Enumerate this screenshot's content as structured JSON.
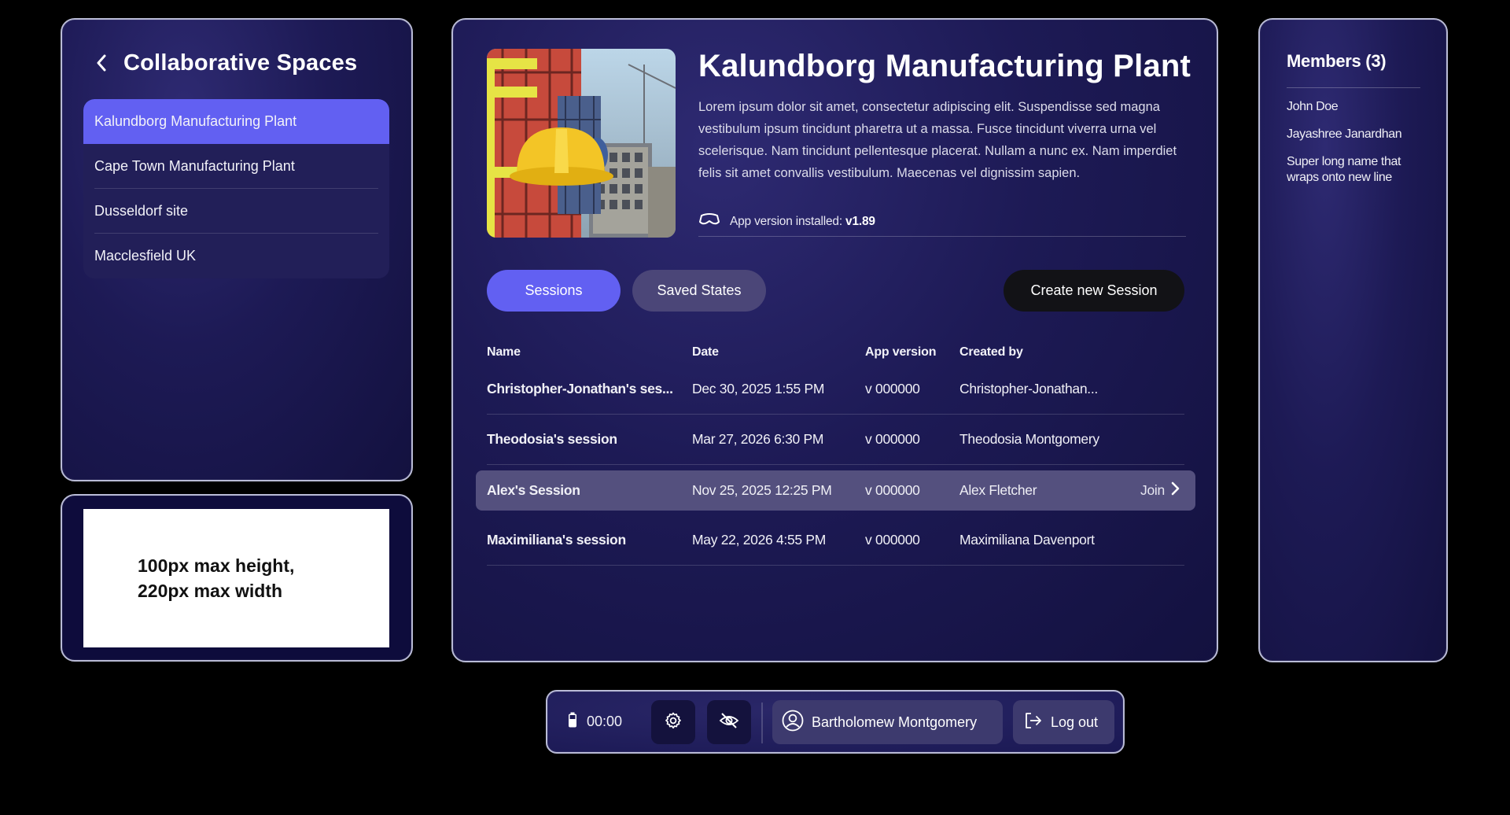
{
  "spaces": {
    "title": "Collaborative Spaces",
    "items": [
      {
        "label": "Kalundborg Manufacturing Plant",
        "active": true
      },
      {
        "label": "Cape Town Manufacturing Plant",
        "active": false
      },
      {
        "label": "Dusseldorf site",
        "active": false
      },
      {
        "label": "Macclesfield UK",
        "active": false
      }
    ]
  },
  "logo_placeholder": {
    "text": "100px max height,\n220px max width"
  },
  "space_detail": {
    "title": "Kalundborg Manufacturing Plant",
    "description": "Lorem ipsum dolor sit amet, consectetur adipiscing elit. Suspendisse sed magna vestibulum ipsum tincidunt pharetra ut a massa. Fusce tincidunt viverra urna vel scelerisque. Nam tincidunt pellentesque placerat. Nullam a nunc ex. Nam imperdiet felis sit amet convallis vestibulum. Maecenas vel dignissim sapien.",
    "version_label": "App version installed:",
    "version_value": "v1.89",
    "tabs": [
      {
        "label": "Sessions",
        "active": true
      },
      {
        "label": "Saved States",
        "active": false
      }
    ],
    "create_button": "Create new Session"
  },
  "sessions_table": {
    "columns": [
      "Name",
      "Date",
      "App version",
      "Created by"
    ],
    "rows": [
      {
        "name": "Christopher-Jonathan's ses...",
        "date": "Dec 30, 2025 1:55 PM",
        "version": "v 000000",
        "creator": "Christopher-Jonathan...",
        "highlighted": false
      },
      {
        "name": "Theodosia's session",
        "date": "Mar 27, 2026 6:30 PM",
        "version": "v 000000",
        "creator": "Theodosia Montgomery",
        "highlighted": false
      },
      {
        "name": "Alex's Session",
        "date": "Nov 25, 2025 12:25 PM",
        "version": "v 000000",
        "creator": "Alex Fletcher",
        "highlighted": true,
        "action": "Join"
      },
      {
        "name": "Maximiliana's session",
        "date": "May 22, 2026 4:55 PM",
        "version": "v 000000",
        "creator": "Maximiliana Davenport",
        "highlighted": false
      }
    ]
  },
  "members": {
    "title": "Members (3)",
    "list": [
      "John Doe",
      "Jayashree Janardhan",
      "Super long name that wraps onto new line"
    ]
  },
  "toolbar": {
    "battery_time": "00:00",
    "settings_icon": "gear-icon",
    "visibility_icon": "eye-off-icon",
    "user_name": "Bartholomew Montgomery",
    "logout_label": "Log out"
  },
  "colors": {
    "accent": "#6260f2",
    "panel_bg": "#1d1a55",
    "dark_button": "#121216"
  }
}
